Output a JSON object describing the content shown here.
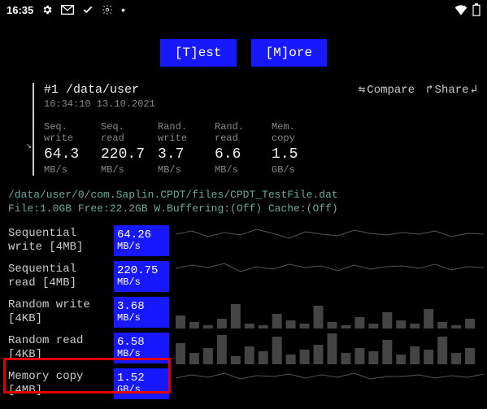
{
  "status": {
    "time": "16:35"
  },
  "buttons": {
    "test": "[T]est",
    "more": "[M]ore"
  },
  "result": {
    "title": "#1 /data/user",
    "timestamp": "16:34:10 13.10.2021",
    "actions": {
      "compare": "Compare",
      "share": "Share"
    }
  },
  "metrics": [
    {
      "label": "Seq.\nwrite",
      "value": "64.3",
      "unit": "MB/s"
    },
    {
      "label": "Seq.\nread",
      "value": "220.7",
      "unit": "MB/s"
    },
    {
      "label": "Rand.\nwrite",
      "value": "3.7",
      "unit": "MB/s"
    },
    {
      "label": "Rand.\nread",
      "value": "6.6",
      "unit": "MB/s"
    },
    {
      "label": "Mem.\ncopy",
      "value": "1.5",
      "unit": "GB/s"
    }
  ],
  "file_info": {
    "line1": "/data/user/0/com.Saplin.CPDT/files/CPDT_TestFile.dat",
    "line2": "File:1.0GB Free:22.2GB W.Buffering:(Off) Cache:(Off)"
  },
  "tests": [
    {
      "label": "Sequential write [4MB]",
      "value": "64.26",
      "unit": "MB/s"
    },
    {
      "label": "Sequential read [4MB]",
      "value": "220.75",
      "unit": "MB/s"
    },
    {
      "label": "Random write [4KB]",
      "value": "3.68",
      "unit": "MB/s"
    },
    {
      "label": "Random read [4KB]",
      "value": "6.58",
      "unit": "MB/s"
    },
    {
      "label": "Memory copy [4MB]",
      "value": "1.52",
      "unit": "GB/s"
    }
  ],
  "chart_data": [
    {
      "type": "line",
      "title": "Sequential write",
      "values": [
        62,
        70,
        58,
        65,
        60,
        72,
        64,
        55,
        68,
        63,
        59,
        71,
        66,
        60,
        64,
        62,
        69,
        58,
        65,
        63
      ]
    },
    {
      "type": "line",
      "title": "Sequential read",
      "values": [
        210,
        225,
        218,
        230,
        200,
        222,
        215,
        228,
        219,
        224,
        208,
        226,
        214,
        220,
        223,
        217,
        229,
        212,
        221,
        218
      ]
    },
    {
      "type": "bar",
      "title": "Random write",
      "values": [
        8,
        4,
        2,
        6,
        15,
        3,
        2,
        9,
        5,
        3,
        14,
        4,
        2,
        7,
        3,
        10,
        5,
        3,
        12,
        4,
        2,
        6
      ]
    },
    {
      "type": "bar",
      "title": "Random read",
      "values": [
        14,
        7,
        10,
        20,
        5,
        11,
        8,
        18,
        6,
        9,
        13,
        22,
        7,
        10,
        8,
        16,
        6,
        11,
        9,
        19,
        7,
        10
      ]
    },
    {
      "type": "line",
      "title": "Memory copy",
      "values": [
        1.48,
        1.55,
        1.5,
        1.58,
        1.47,
        1.53,
        1.51,
        1.56,
        1.49,
        1.54,
        1.5,
        1.57,
        1.48,
        1.52,
        1.51,
        1.55,
        1.49,
        1.53,
        1.5,
        1.56
      ]
    }
  ],
  "colors": {
    "accent": "#1818ff",
    "highlight": "#e00000",
    "path": "#6a9"
  }
}
